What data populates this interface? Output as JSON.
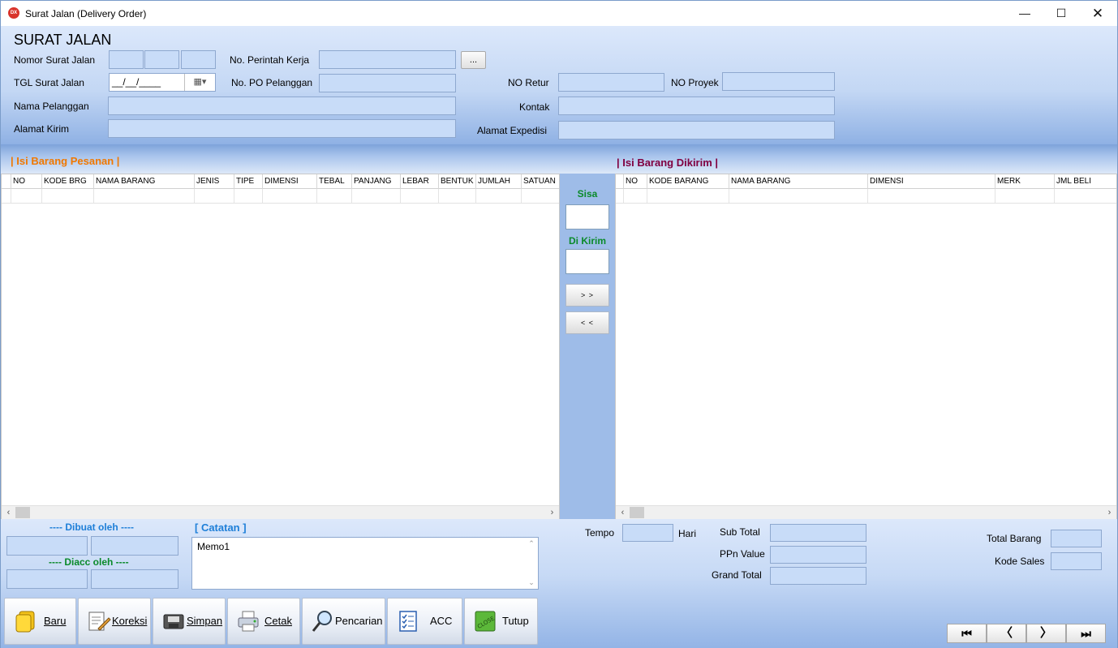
{
  "window": {
    "title": "Surat Jalan (Delivery Order)",
    "icon": "app-dx-icon"
  },
  "header": {
    "heading": "SURAT JALAN",
    "labels": {
      "nomor_sj": "Nomor Surat Jalan",
      "tgl_sj": "TGL Surat Jalan",
      "nama_pelanggan": "Nama Pelanggan",
      "alamat_kirim": "Alamat Kirim",
      "no_perintah_kerja": "No. Perintah Kerja",
      "no_po_pelanggan": "No. PO Pelanggan",
      "no_retur": "NO Retur",
      "no_proyek": "NO Proyek",
      "kontak": "Kontak",
      "alamat_expedisi": "Alamat Expedisi"
    },
    "date_mask": "__/__/____",
    "ellipsis_label": "..."
  },
  "left_grid": {
    "title": "| Isi Barang Pesanan |",
    "columns": [
      "NO",
      "KODE BRG",
      "NAMA BARANG",
      "JENIS",
      "TIPE",
      "DIMENSI",
      "TEBAL",
      "PANJANG",
      "LEBAR",
      "BENTUK",
      "JUMLAH",
      "SATUAN"
    ]
  },
  "right_grid": {
    "title": "| Isi Barang Dikirim |",
    "columns": [
      "NO",
      "KODE BARANG",
      "NAMA BARANG",
      "DIMENSI",
      "MERK",
      "JML BELI"
    ]
  },
  "middle": {
    "sisa": "Sisa",
    "di_kirim": "Di Kirim",
    "move_right": "> >",
    "move_left": "< <"
  },
  "footer": {
    "dibuat_oleh": "---- Dibuat oleh ----",
    "diacc_oleh": "---- Diacc oleh ----",
    "catatan": "[ Catatan ]",
    "memo_value": "Memo1",
    "tempo": "Tempo",
    "hari": "Hari",
    "sub_total": "Sub Total",
    "ppn_value": "PPn Value",
    "grand_total": "Grand Total",
    "total_barang": "Total Barang",
    "kode_sales": "Kode Sales"
  },
  "toolbar": {
    "baru": "Baru",
    "koreksi": "Koreksi",
    "simpan": "Simpan",
    "cetak": "Cetak",
    "pencarian": "Pencarian",
    "acc": "ACC",
    "tutup": "Tutup"
  },
  "colors": {
    "accent_orange": "#f07800",
    "purple": "#800040",
    "green": "#0a8a2a",
    "blue": "#1e7fd8",
    "field_bg": "#c8dcf8"
  }
}
